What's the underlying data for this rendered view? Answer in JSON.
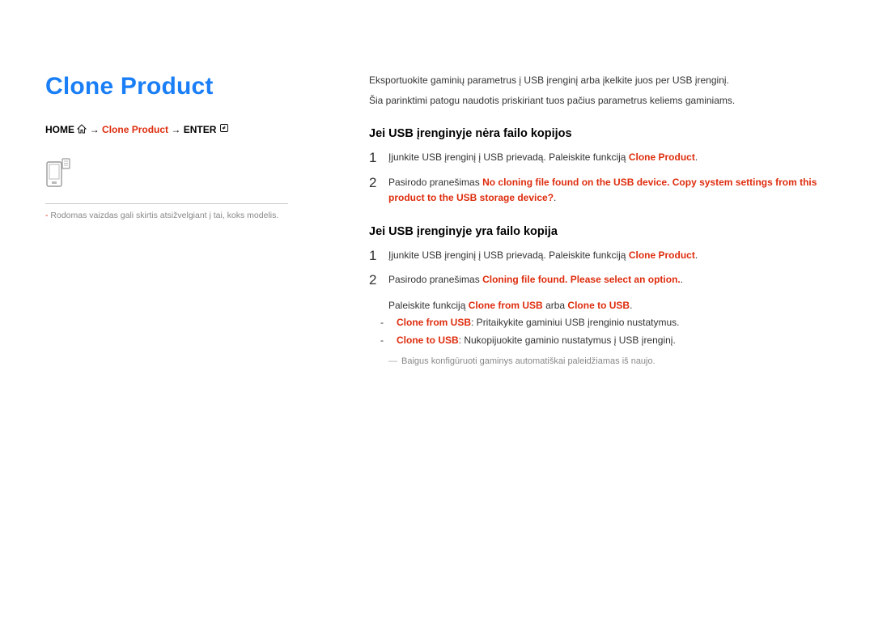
{
  "title": "Clone Product",
  "breadcrumb": {
    "home": "HOME",
    "arrow": "→",
    "clone": "Clone Product",
    "enter": "ENTER"
  },
  "caption_prefix": "- ",
  "caption": "Rodomas vaizdas gali skirtis atsižvelgiant į tai, koks modelis.",
  "intro1": "Eksportuokite gaminių parametrus į USB įrenginį arba įkelkite juos per USB įrenginį.",
  "intro2": "Šia parinktimi patogu naudotis priskiriant tuos pačius parametrus keliems gaminiams.",
  "section1": {
    "heading": "Jei USB įrenginyje nėra failo kopijos",
    "step1": {
      "num": "1",
      "pre": "Įjunkite USB įrenginį į USB prievadą. Paleiskite funkciją ",
      "emph": "Clone Product",
      "post": "."
    },
    "step2": {
      "num": "2",
      "pre": "Pasirodo pranešimas ",
      "emph": "No cloning file found on the USB device. Copy system settings from this product to the USB storage device?",
      "post": "."
    }
  },
  "section2": {
    "heading": "Jei USB įrenginyje yra failo kopija",
    "step1": {
      "num": "1",
      "pre": "Įjunkite USB įrenginį į USB prievadą. Paleiskite funkciją ",
      "emph": "Clone Product",
      "post": "."
    },
    "step2": {
      "num": "2",
      "pre": "Pasirodo pranešimas ",
      "emph": "Cloning file found. Please select an option.",
      "post": "."
    },
    "subintro_pre": "Paleiskite funkciją ",
    "subintro_e1": "Clone from USB",
    "subintro_mid": " arba ",
    "subintro_e2": "Clone to USB",
    "subintro_post": ".",
    "bullet1_emph": "Clone from USB",
    "bullet1_text": ": Pritaikykite gaminiui USB įrenginio nustatymus.",
    "bullet2_emph": "Clone to USB",
    "bullet2_text": ": Nukopijuokite gaminio nustatymus į USB įrenginį.",
    "note": "Baigus konfigūruoti gaminys automatiškai paleidžiamas iš naujo."
  }
}
